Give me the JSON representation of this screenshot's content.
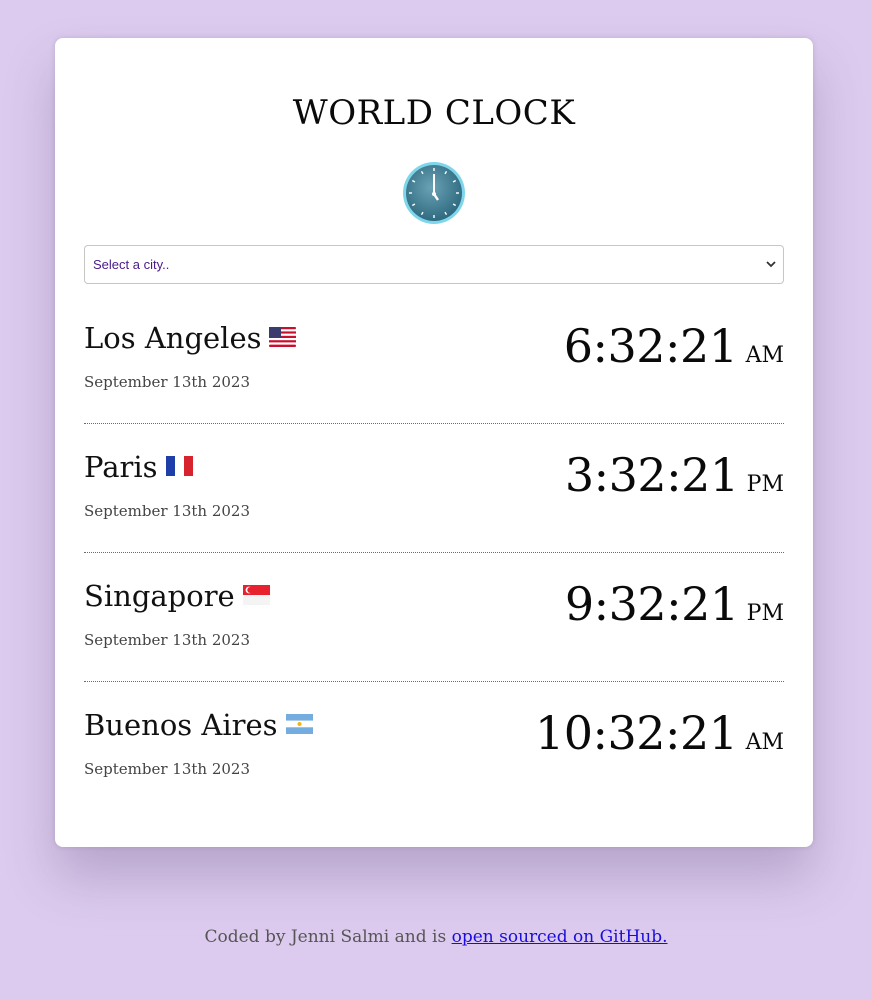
{
  "header": {
    "title": "WORLD CLOCK"
  },
  "select": {
    "placeholder": "Select a city.."
  },
  "cities": [
    {
      "name": "Los Angeles",
      "flag": "us-flag-icon",
      "date": "September 13th 2023",
      "time": "6:32:21",
      "ampm": "AM"
    },
    {
      "name": "Paris",
      "flag": "france-flag-icon",
      "date": "September 13th 2023",
      "time": "3:32:21",
      "ampm": "PM"
    },
    {
      "name": "Singapore",
      "flag": "singapore-flag-icon",
      "date": "September 13th 2023",
      "time": "9:32:21",
      "ampm": "PM"
    },
    {
      "name": "Buenos Aires",
      "flag": "argentina-flag-icon",
      "date": "September 13th 2023",
      "time": "10:32:21",
      "ampm": "AM"
    }
  ],
  "footer": {
    "text": "Coded by Jenni Salmi and is ",
    "link": "open sourced on GitHub."
  },
  "colors": {
    "background": "#dccbee",
    "card": "#ffffff",
    "link": "#1a0ddb"
  }
}
